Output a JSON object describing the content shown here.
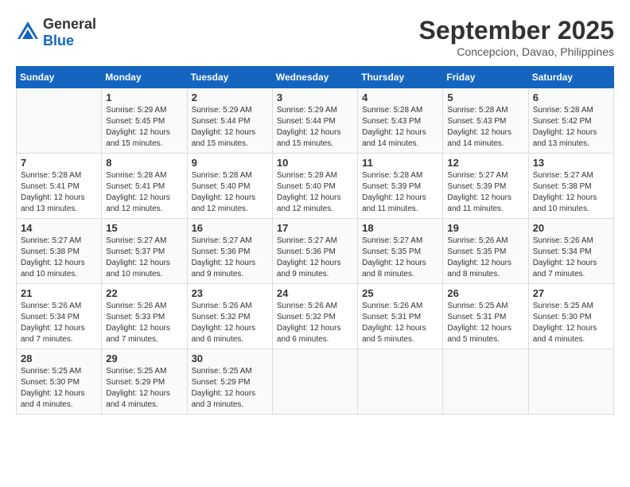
{
  "header": {
    "logo_general": "General",
    "logo_blue": "Blue",
    "month_title": "September 2025",
    "subtitle": "Concepcion, Davao, Philippines"
  },
  "calendar": {
    "days_of_week": [
      "Sunday",
      "Monday",
      "Tuesday",
      "Wednesday",
      "Thursday",
      "Friday",
      "Saturday"
    ],
    "weeks": [
      [
        {
          "day": "",
          "info": ""
        },
        {
          "day": "1",
          "info": "Sunrise: 5:29 AM\nSunset: 5:45 PM\nDaylight: 12 hours\nand 15 minutes."
        },
        {
          "day": "2",
          "info": "Sunrise: 5:29 AM\nSunset: 5:44 PM\nDaylight: 12 hours\nand 15 minutes."
        },
        {
          "day": "3",
          "info": "Sunrise: 5:29 AM\nSunset: 5:44 PM\nDaylight: 12 hours\nand 15 minutes."
        },
        {
          "day": "4",
          "info": "Sunrise: 5:28 AM\nSunset: 5:43 PM\nDaylight: 12 hours\nand 14 minutes."
        },
        {
          "day": "5",
          "info": "Sunrise: 5:28 AM\nSunset: 5:43 PM\nDaylight: 12 hours\nand 14 minutes."
        },
        {
          "day": "6",
          "info": "Sunrise: 5:28 AM\nSunset: 5:42 PM\nDaylight: 12 hours\nand 13 minutes."
        }
      ],
      [
        {
          "day": "7",
          "info": "Sunrise: 5:28 AM\nSunset: 5:41 PM\nDaylight: 12 hours\nand 13 minutes."
        },
        {
          "day": "8",
          "info": "Sunrise: 5:28 AM\nSunset: 5:41 PM\nDaylight: 12 hours\nand 12 minutes."
        },
        {
          "day": "9",
          "info": "Sunrise: 5:28 AM\nSunset: 5:40 PM\nDaylight: 12 hours\nand 12 minutes."
        },
        {
          "day": "10",
          "info": "Sunrise: 5:28 AM\nSunset: 5:40 PM\nDaylight: 12 hours\nand 12 minutes."
        },
        {
          "day": "11",
          "info": "Sunrise: 5:28 AM\nSunset: 5:39 PM\nDaylight: 12 hours\nand 11 minutes."
        },
        {
          "day": "12",
          "info": "Sunrise: 5:27 AM\nSunset: 5:39 PM\nDaylight: 12 hours\nand 11 minutes."
        },
        {
          "day": "13",
          "info": "Sunrise: 5:27 AM\nSunset: 5:38 PM\nDaylight: 12 hours\nand 10 minutes."
        }
      ],
      [
        {
          "day": "14",
          "info": "Sunrise: 5:27 AM\nSunset: 5:38 PM\nDaylight: 12 hours\nand 10 minutes."
        },
        {
          "day": "15",
          "info": "Sunrise: 5:27 AM\nSunset: 5:37 PM\nDaylight: 12 hours\nand 10 minutes."
        },
        {
          "day": "16",
          "info": "Sunrise: 5:27 AM\nSunset: 5:36 PM\nDaylight: 12 hours\nand 9 minutes."
        },
        {
          "day": "17",
          "info": "Sunrise: 5:27 AM\nSunset: 5:36 PM\nDaylight: 12 hours\nand 9 minutes."
        },
        {
          "day": "18",
          "info": "Sunrise: 5:27 AM\nSunset: 5:35 PM\nDaylight: 12 hours\nand 8 minutes."
        },
        {
          "day": "19",
          "info": "Sunrise: 5:26 AM\nSunset: 5:35 PM\nDaylight: 12 hours\nand 8 minutes."
        },
        {
          "day": "20",
          "info": "Sunrise: 5:26 AM\nSunset: 5:34 PM\nDaylight: 12 hours\nand 7 minutes."
        }
      ],
      [
        {
          "day": "21",
          "info": "Sunrise: 5:26 AM\nSunset: 5:34 PM\nDaylight: 12 hours\nand 7 minutes."
        },
        {
          "day": "22",
          "info": "Sunrise: 5:26 AM\nSunset: 5:33 PM\nDaylight: 12 hours\nand 7 minutes."
        },
        {
          "day": "23",
          "info": "Sunrise: 5:26 AM\nSunset: 5:32 PM\nDaylight: 12 hours\nand 6 minutes."
        },
        {
          "day": "24",
          "info": "Sunrise: 5:26 AM\nSunset: 5:32 PM\nDaylight: 12 hours\nand 6 minutes."
        },
        {
          "day": "25",
          "info": "Sunrise: 5:26 AM\nSunset: 5:31 PM\nDaylight: 12 hours\nand 5 minutes."
        },
        {
          "day": "26",
          "info": "Sunrise: 5:25 AM\nSunset: 5:31 PM\nDaylight: 12 hours\nand 5 minutes."
        },
        {
          "day": "27",
          "info": "Sunrise: 5:25 AM\nSunset: 5:30 PM\nDaylight: 12 hours\nand 4 minutes."
        }
      ],
      [
        {
          "day": "28",
          "info": "Sunrise: 5:25 AM\nSunset: 5:30 PM\nDaylight: 12 hours\nand 4 minutes."
        },
        {
          "day": "29",
          "info": "Sunrise: 5:25 AM\nSunset: 5:29 PM\nDaylight: 12 hours\nand 4 minutes."
        },
        {
          "day": "30",
          "info": "Sunrise: 5:25 AM\nSunset: 5:29 PM\nDaylight: 12 hours\nand 3 minutes."
        },
        {
          "day": "",
          "info": ""
        },
        {
          "day": "",
          "info": ""
        },
        {
          "day": "",
          "info": ""
        },
        {
          "day": "",
          "info": ""
        }
      ]
    ]
  }
}
